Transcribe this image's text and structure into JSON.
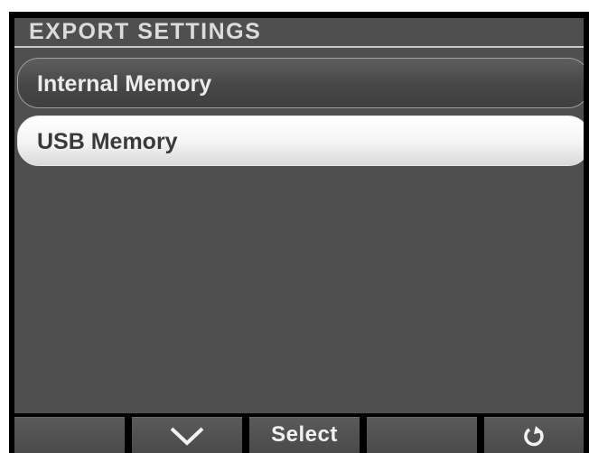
{
  "header": {
    "title": "EXPORT SETTINGS"
  },
  "menu": {
    "items": [
      {
        "label": "Internal Memory",
        "selected": false
      },
      {
        "label": "USB Memory",
        "selected": true
      }
    ]
  },
  "softkeys": [
    {
      "label": "",
      "icon": ""
    },
    {
      "label": "",
      "icon": "chevron-down-icon"
    },
    {
      "label": "Select",
      "icon": ""
    },
    {
      "label": "",
      "icon": ""
    },
    {
      "label": "",
      "icon": "back-arrow-icon"
    }
  ],
  "colors": {
    "background": "#4f4f4f",
    "bezel": "#000000",
    "selected_item": "#ffffff",
    "unselected_item_border": "#9aa0a8",
    "title_text": "#dcdcdc"
  }
}
